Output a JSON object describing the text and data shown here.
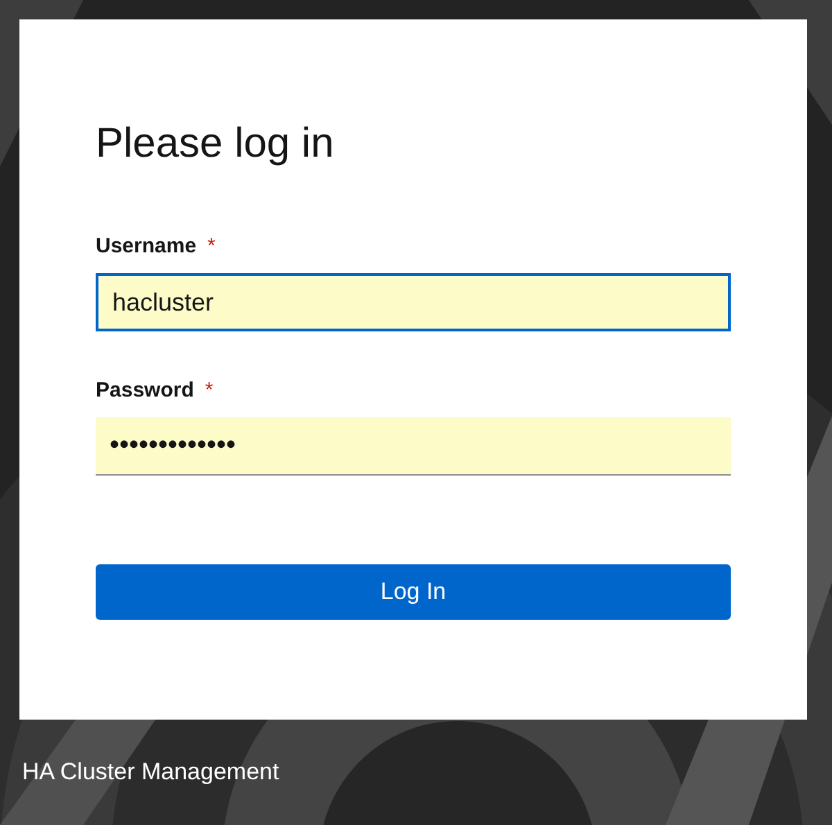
{
  "login": {
    "title": "Please log in",
    "fields": [
      {
        "label": "Username",
        "required_mark": "*",
        "value": "hacluster",
        "focused": true
      },
      {
        "label": "Password",
        "required_mark": "*",
        "value": "•••••••••••••",
        "focused": false
      }
    ],
    "submit": "Log In"
  },
  "footer": {
    "brand": "HA Cluster Management"
  }
}
